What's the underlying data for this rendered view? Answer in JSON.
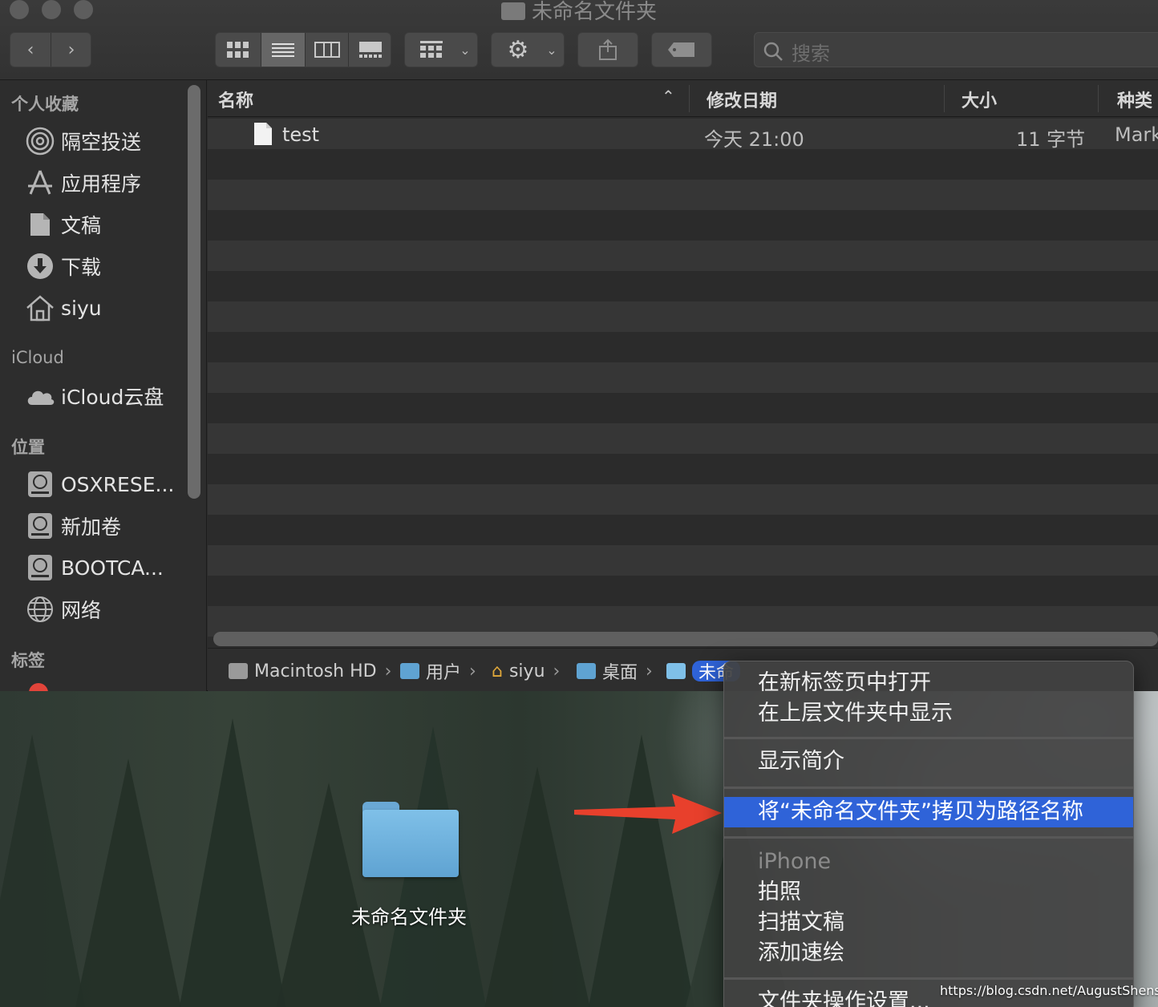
{
  "window": {
    "title": "未命名文件夹"
  },
  "toolbar": {
    "view_modes": [
      "icon-view",
      "list-view",
      "column-view",
      "gallery-view"
    ],
    "active_view": "list-view"
  },
  "search": {
    "placeholder": "搜索"
  },
  "sidebar": {
    "favorites_header": "个人收藏",
    "favorites": [
      {
        "label": "隔空投送",
        "icon": "airdrop-icon"
      },
      {
        "label": "应用程序",
        "icon": "applications-icon"
      },
      {
        "label": "文稿",
        "icon": "documents-icon"
      },
      {
        "label": "下载",
        "icon": "downloads-icon"
      },
      {
        "label": "siyu",
        "icon": "home-icon"
      }
    ],
    "icloud_header": "iCloud",
    "icloud": [
      {
        "label": "iCloud云盘",
        "icon": "cloud-icon"
      }
    ],
    "locations_header": "位置",
    "locations": [
      {
        "label": "OSXRESE...",
        "icon": "disk-icon"
      },
      {
        "label": "新加卷",
        "icon": "disk-icon"
      },
      {
        "label": "BOOTCA...",
        "icon": "disk-icon"
      },
      {
        "label": "网络",
        "icon": "globe-icon"
      }
    ],
    "tags_header": "标签"
  },
  "list": {
    "columns": {
      "name": "名称",
      "date": "修改日期",
      "size": "大小",
      "kind": "种类"
    },
    "rows": [
      {
        "name": "test",
        "date": "今天 21:00",
        "size": "11 字节",
        "kind": "Mark"
      }
    ]
  },
  "pathbar": {
    "crumbs": [
      "Macintosh HD",
      "用户",
      "siyu",
      "桌面",
      "未命"
    ]
  },
  "desktop": {
    "folder_label": "未命名文件夹"
  },
  "context_menu": {
    "items": [
      {
        "label": "在新标签页中打开"
      },
      {
        "label": "在上层文件夹中显示"
      },
      {
        "label": "显示简介"
      },
      {
        "label": "将“未命名文件夹”拷贝为路径名称"
      },
      {
        "label": "iPhone"
      },
      {
        "label": "拍照"
      },
      {
        "label": "扫描文稿"
      },
      {
        "label": "添加速绘"
      },
      {
        "label": "文件夹操作设置..."
      }
    ]
  },
  "watermark": "https://blog.csdn.net/AugustShensiyu",
  "colors": {
    "accent": "#2f63d8",
    "arrow": "#e8402c",
    "folder": "#6aa8d4"
  }
}
